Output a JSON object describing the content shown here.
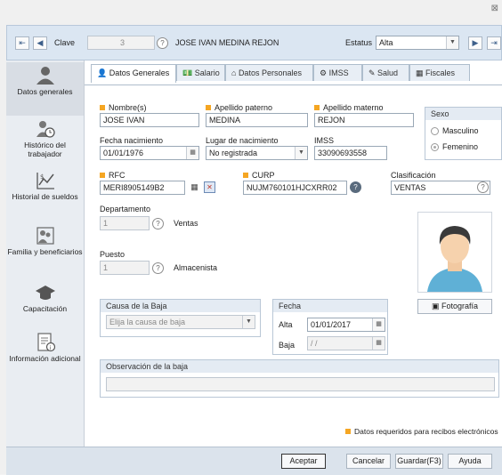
{
  "window": {
    "close_glyph": "⊠"
  },
  "topbar": {
    "clave_label": "Clave",
    "clave_value": "3",
    "employee_name": "JOSE IVAN MEDINA REJON",
    "estatus_label": "Estatus",
    "estatus_value": "Alta"
  },
  "sidebar": {
    "items": [
      {
        "label": "Datos generales",
        "icon": "person-icon"
      },
      {
        "label": "Histórico del trabajador",
        "icon": "history-icon"
      },
      {
        "label": "Historial de sueldos",
        "icon": "salary-chart-icon"
      },
      {
        "label": "Familia y beneficiarios",
        "icon": "family-icon"
      },
      {
        "label": "Capacitación",
        "icon": "graduation-cap-icon"
      },
      {
        "label": "Información adicional",
        "icon": "info-document-icon"
      }
    ]
  },
  "tabs": [
    {
      "label": "Datos Generales"
    },
    {
      "label": "Salario"
    },
    {
      "label": "Datos Personales"
    },
    {
      "label": "IMSS"
    },
    {
      "label": "Salud"
    },
    {
      "label": "Fiscales"
    }
  ],
  "form": {
    "nombre_label": "Nombre(s)",
    "nombre_value": "JOSE IVAN",
    "paterno_label": "Apellido paterno",
    "paterno_value": "MEDINA",
    "materno_label": "Apellido materno",
    "materno_value": "REJON",
    "sexo_title": "Sexo",
    "sexo_masculino": "Masculino",
    "sexo_femenino": "Femenino",
    "fecha_nac_label": "Fecha nacimiento",
    "fecha_nac_value": "01/01/1976",
    "lugar_label": "Lugar de nacimiento",
    "lugar_value": "No registrada",
    "imss_label": "IMSS",
    "imss_value": "33090693558",
    "rfc_label": "RFC",
    "rfc_value": "MERI8905149B2",
    "curp_label": "CURP",
    "curp_value": "NUJM760101HJCXRR02",
    "clasificacion_label": "Clasificación",
    "clasificacion_value": "VENTAS",
    "departamento_label": "Departamento",
    "departamento_value": "1",
    "departamento_name": "Ventas",
    "puesto_label": "Puesto",
    "puesto_value": "1",
    "puesto_name": "Almacenista",
    "foto_button": "Fotografía",
    "baja_title": "Causa de la Baja",
    "baja_placeholder": "Elija la causa de baja",
    "fecha_title": "Fecha",
    "alta_label": "Alta",
    "alta_value": "01/01/2017",
    "baja_label": "Baja",
    "baja_value": " / /",
    "observacion_title": "Observación de la baja",
    "required_note": "Datos requeridos para recibos electrónicos"
  },
  "buttons": {
    "aceptar": "Aceptar",
    "cancelar": "Cancelar",
    "guardar": "Guardar(F3)",
    "ayuda": "Ayuda"
  },
  "colors": {
    "required": "#f5a623",
    "topbar": "#dbe6f2",
    "sidebar": "#e9edf2"
  }
}
